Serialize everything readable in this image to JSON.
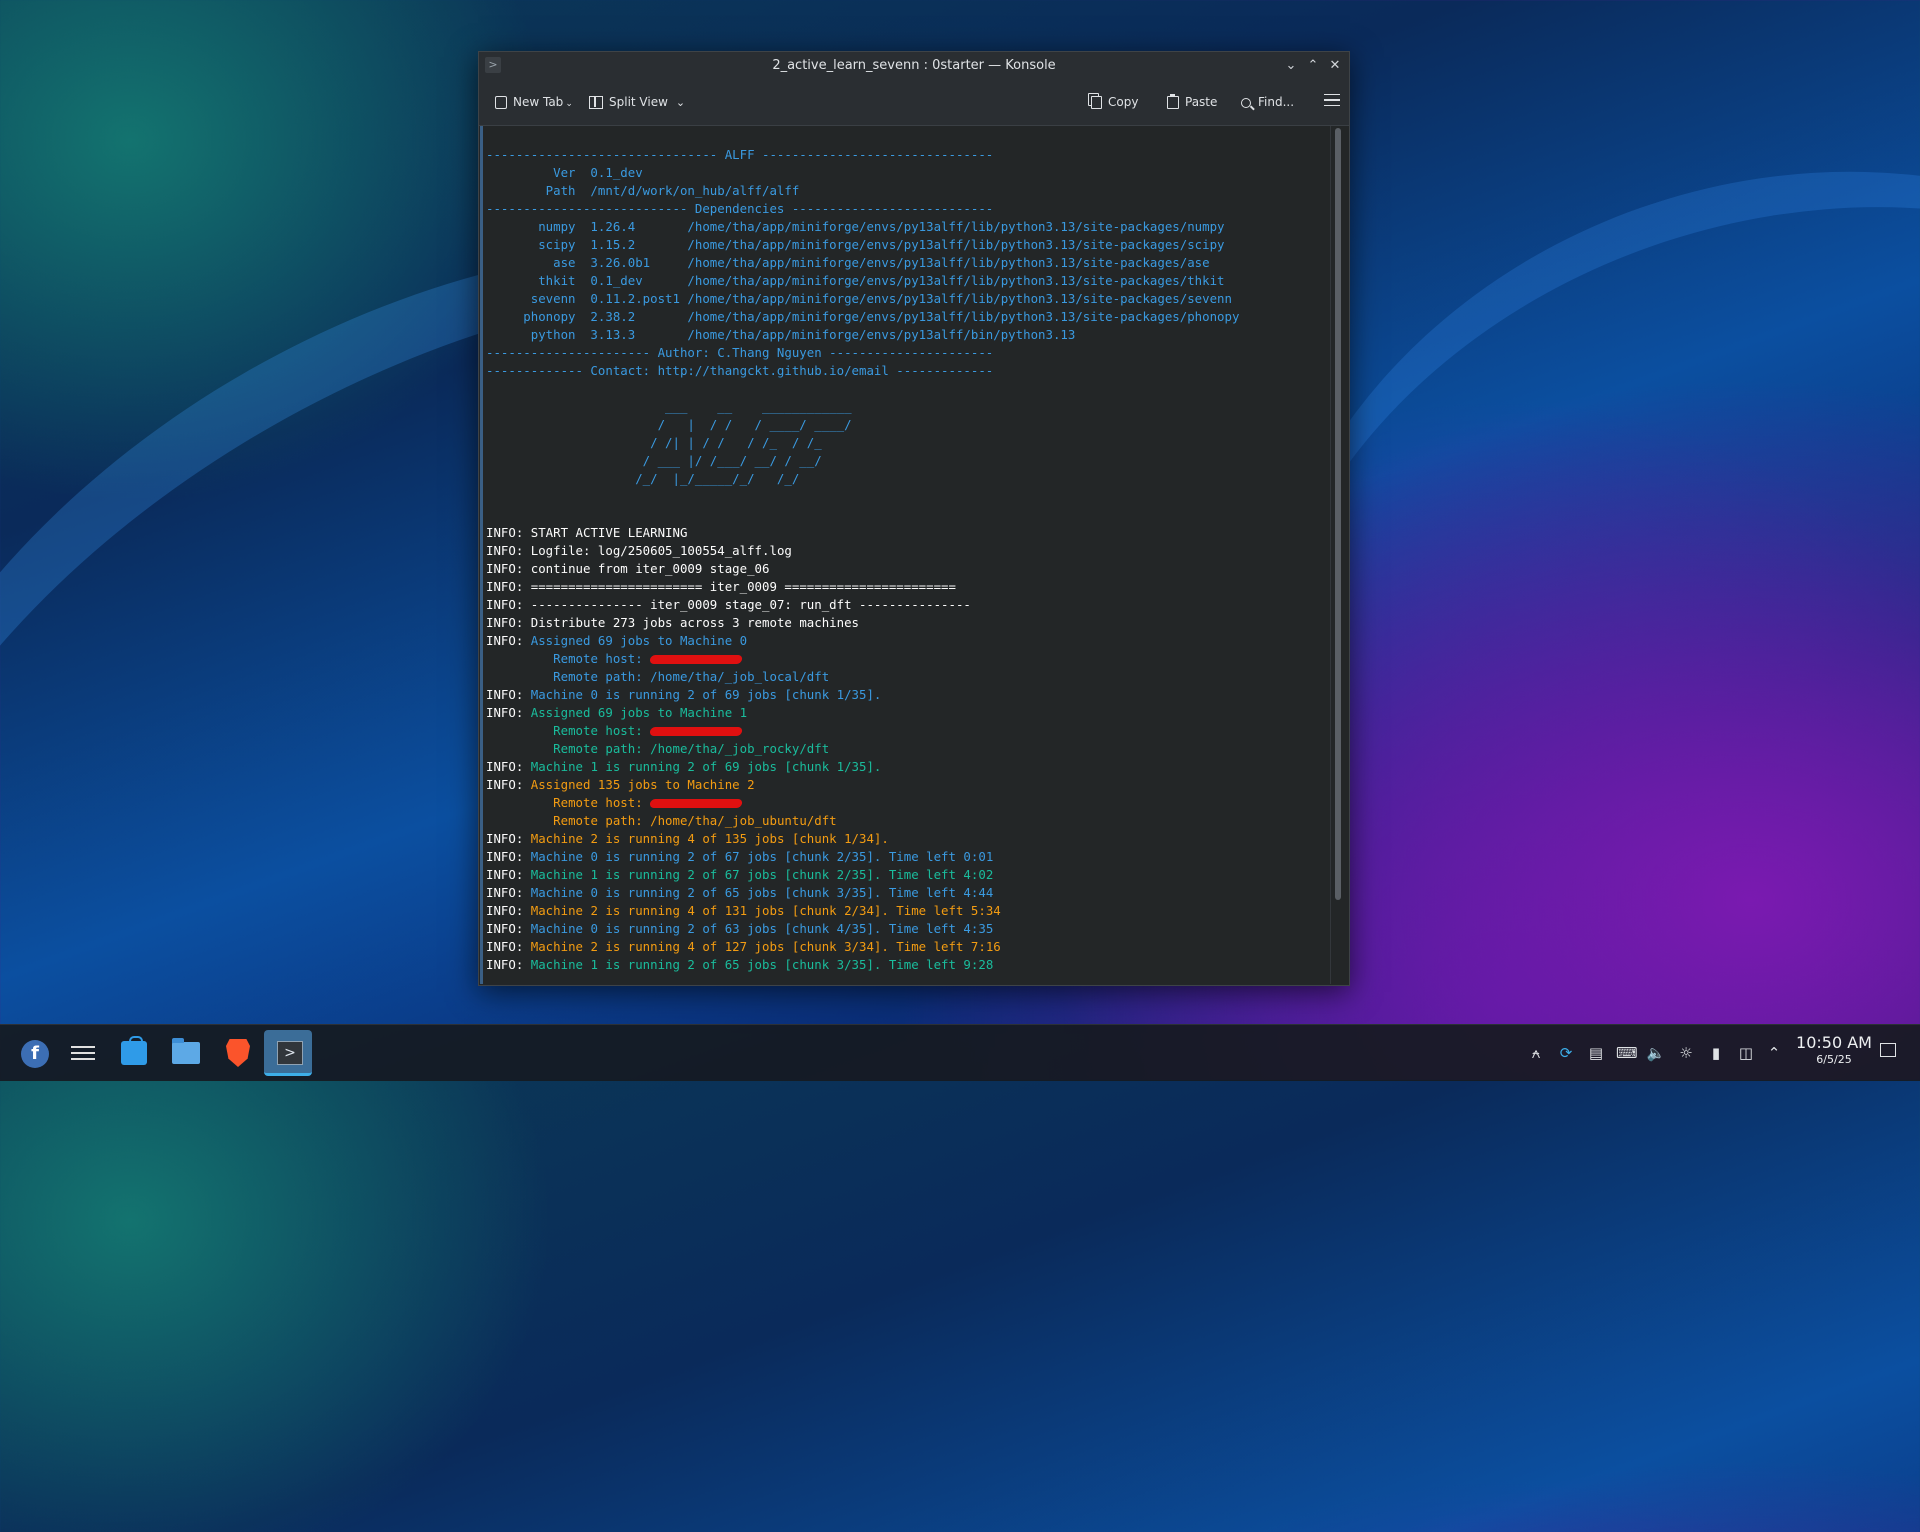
{
  "window": {
    "title": "2_active_learn_sevenn : 0starter — Konsole",
    "app_icon": "konsole-prompt-icon"
  },
  "toolbar": {
    "new_tab": "New Tab",
    "split_view": "Split View",
    "copy": "Copy",
    "paste": "Paste",
    "find": "Find..."
  },
  "terminal": {
    "lines": [
      {
        "text": "------------------------------- ALFF -------------------------------",
        "color": "blue"
      },
      {
        "text": "         Ver  0.1_dev",
        "color": "blue"
      },
      {
        "text": "        Path  /mnt/d/work/on_hub/alff/alff",
        "color": "blue"
      },
      {
        "text": "--------------------------- Dependencies ---------------------------",
        "color": "blue"
      },
      {
        "text": "       numpy  1.26.4       /home/tha/app/miniforge/envs/py13alff/lib/python3.13/site-packages/numpy",
        "color": "blue"
      },
      {
        "text": "       scipy  1.15.2       /home/tha/app/miniforge/envs/py13alff/lib/python3.13/site-packages/scipy",
        "color": "blue"
      },
      {
        "text": "         ase  3.26.0b1     /home/tha/app/miniforge/envs/py13alff/lib/python3.13/site-packages/ase",
        "color": "blue"
      },
      {
        "text": "       thkit  0.1_dev      /home/tha/app/miniforge/envs/py13alff/lib/python3.13/site-packages/thkit",
        "color": "blue"
      },
      {
        "text": "      sevenn  0.11.2.post1 /home/tha/app/miniforge/envs/py13alff/lib/python3.13/site-packages/sevenn",
        "color": "blue"
      },
      {
        "text": "     phonopy  2.38.2       /home/tha/app/miniforge/envs/py13alff/lib/python3.13/site-packages/phonopy",
        "color": "blue"
      },
      {
        "text": "      python  3.13.3       /home/tha/app/miniforge/envs/py13alff/bin/python3.13",
        "color": "blue"
      },
      {
        "text": "---------------------- Author: C.Thang Nguyen ----------------------",
        "color": "blue"
      },
      {
        "text": "------------- Contact: http://thangckt.github.io/email -------------",
        "color": "blue"
      },
      {
        "text": "",
        "color": "blue"
      },
      {
        "text": "                        ___    __    ____________",
        "color": "blue"
      },
      {
        "text": "                       /   |  / /   / ____/ ____/",
        "color": "blue"
      },
      {
        "text": "                      / /| | / /   / /_  / /_",
        "color": "blue"
      },
      {
        "text": "                     / ___ |/ /___/ __/ / __/",
        "color": "blue"
      },
      {
        "text": "                    /_/  |_/_____/_/   /_/",
        "color": "blue"
      },
      {
        "text": "",
        "color": "blue"
      },
      {
        "text": "",
        "color": "blue"
      },
      {
        "prefix": "INFO: ",
        "text": "START ACTIVE LEARNING",
        "color": "white"
      },
      {
        "prefix": "INFO: ",
        "text": "Logfile: log/250605_100554_alff.log",
        "color": "white"
      },
      {
        "prefix": "INFO: ",
        "text": "continue from iter_0009 stage_06",
        "color": "white"
      },
      {
        "prefix": "INFO: ",
        "text": "======================= iter_0009 =======================",
        "color": "white"
      },
      {
        "prefix": "INFO: ",
        "text": "--------------- iter_0009 stage_07: run_dft ---------------",
        "color": "white"
      },
      {
        "prefix": "INFO: ",
        "text": "Distribute 273 jobs across 3 remote machines",
        "color": "white"
      },
      {
        "prefix": "INFO: ",
        "text": "Assigned 69 jobs to Machine 0",
        "color": "blue"
      },
      {
        "prefix": "     ",
        "text": "    Remote host: ",
        "color": "blue",
        "redacted": true
      },
      {
        "prefix": "     ",
        "text": "    Remote path: /home/tha/_job_local/dft",
        "color": "blue"
      },
      {
        "prefix": "INFO: ",
        "text": "Machine 0 is running 2 of 69 jobs [chunk 1/35].",
        "color": "blue"
      },
      {
        "prefix": "INFO: ",
        "text": "Assigned 69 jobs to Machine 1",
        "color": "teal"
      },
      {
        "prefix": "     ",
        "text": "    Remote host: ",
        "color": "teal",
        "redacted": true
      },
      {
        "prefix": "     ",
        "text": "    Remote path: /home/tha/_job_rocky/dft",
        "color": "teal"
      },
      {
        "prefix": "INFO: ",
        "text": "Machine 1 is running 2 of 69 jobs [chunk 1/35].",
        "color": "teal"
      },
      {
        "prefix": "INFO: ",
        "text": "Assigned 135 jobs to Machine 2",
        "color": "orange"
      },
      {
        "prefix": "     ",
        "text": "    Remote host: ",
        "color": "orange",
        "redacted": true
      },
      {
        "prefix": "     ",
        "text": "    Remote path: /home/tha/_job_ubuntu/dft",
        "color": "orange"
      },
      {
        "prefix": "INFO: ",
        "text": "Machine 2 is running 4 of 135 jobs [chunk 1/34].",
        "color": "orange"
      },
      {
        "prefix": "INFO: ",
        "text": "Machine 0 is running 2 of 67 jobs [chunk 2/35]. Time left 0:01",
        "color": "blue"
      },
      {
        "prefix": "INFO: ",
        "text": "Machine 1 is running 2 of 67 jobs [chunk 2/35]. Time left 4:02",
        "color": "teal"
      },
      {
        "prefix": "INFO: ",
        "text": "Machine 0 is running 2 of 65 jobs [chunk 3/35]. Time left 4:44",
        "color": "blue"
      },
      {
        "prefix": "INFO: ",
        "text": "Machine 2 is running 4 of 131 jobs [chunk 2/34]. Time left 5:34",
        "color": "orange"
      },
      {
        "prefix": "INFO: ",
        "text": "Machine 0 is running 2 of 63 jobs [chunk 4/35]. Time left 4:35",
        "color": "blue"
      },
      {
        "prefix": "INFO: ",
        "text": "Machine 2 is running 4 of 127 jobs [chunk 3/34]. Time left 7:16",
        "color": "orange"
      },
      {
        "prefix": "INFO: ",
        "text": "Machine 1 is running 2 of 65 jobs [chunk 3/35]. Time left 9:28",
        "color": "teal"
      }
    ]
  },
  "taskbar": {
    "apps": [
      "fedora-launcher-icon",
      "system-settings-icon",
      "discover-store-icon",
      "dolphin-files-icon",
      "brave-browser-icon",
      "konsole-icon"
    ],
    "tray_icons": [
      "notifications-icon",
      "sync-icon",
      "clipboard-icon",
      "keyboard-icon",
      "volume-icon",
      "brightness-icon",
      "battery-icon",
      "network-icon",
      "expand-tray-icon"
    ],
    "clock_time": "10:50 AM",
    "clock_date": "6/5/25"
  },
  "colors": {
    "blue": "#3a9ae0",
    "teal": "#1abc9c",
    "orange": "#f39c12",
    "white": "#fcfcfc",
    "redaction": "#e01010"
  }
}
